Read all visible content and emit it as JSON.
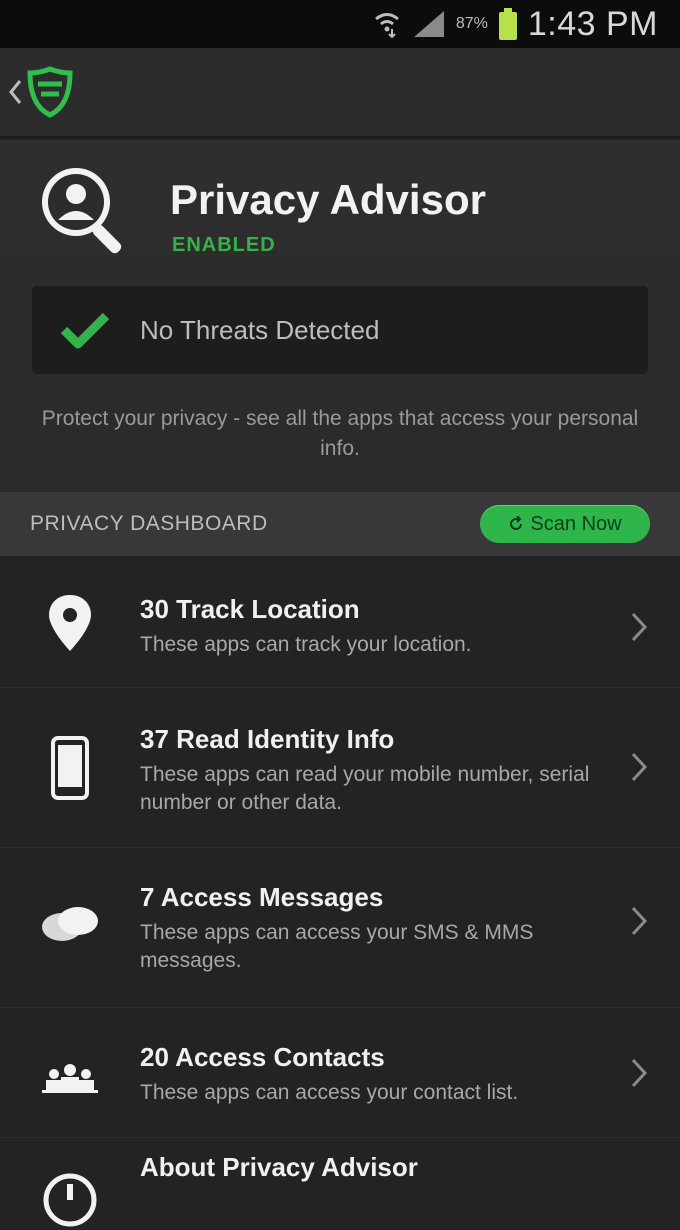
{
  "status_bar": {
    "battery_percent": "87%",
    "time": "1:43 PM"
  },
  "action_bar": {
    "icons": [
      "chevron-left-icon",
      "shield-logo-icon"
    ]
  },
  "header": {
    "title": "Privacy Advisor",
    "status": "ENABLED",
    "threat_message": "No Threats Detected",
    "description": "Protect your privacy - see all the apps that access your personal info."
  },
  "dashboard": {
    "section_title": "PRIVACY DASHBOARD",
    "scan_button_label": "Scan Now",
    "items": [
      {
        "title": "30 Track Location",
        "description": "These apps can track your location.",
        "icon": "location-pin-icon"
      },
      {
        "title": "37 Read Identity Info",
        "description": "These apps can read your mobile number, serial number or other data.",
        "icon": "phone-icon"
      },
      {
        "title": "7 Access Messages",
        "description": "These apps can access your SMS & MMS messages.",
        "icon": "chat-bubbles-icon"
      },
      {
        "title": "20 Access Contacts",
        "description": "These apps can access your contact list.",
        "icon": "contacts-icon"
      },
      {
        "title": "About Privacy Advisor",
        "description": "",
        "icon": "info-icon"
      }
    ]
  },
  "colors": {
    "accent_green": "#35b34a",
    "background": "#232323"
  }
}
